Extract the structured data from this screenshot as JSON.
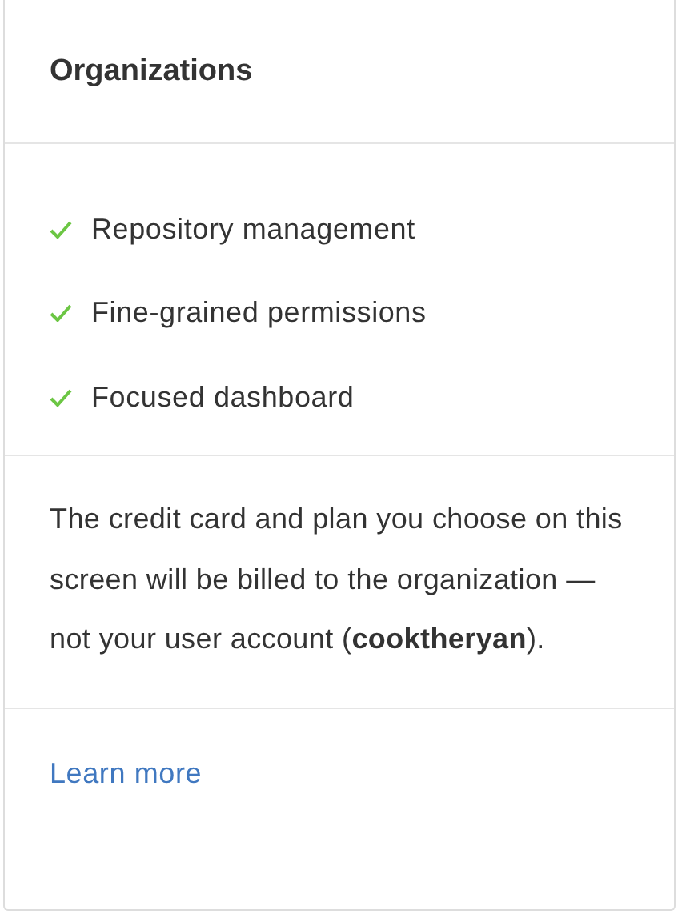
{
  "title": "Organizations",
  "features": [
    {
      "label": "Repository management",
      "checked": true
    },
    {
      "label": "Fine-grained permissions",
      "checked": true
    },
    {
      "label": "Focused dashboard",
      "checked": true
    }
  ],
  "note": "The credit card and plan you choose on this screen will be billed to the organization — not your user account (**cooktheryan**).",
  "link": "Learn more"
}
